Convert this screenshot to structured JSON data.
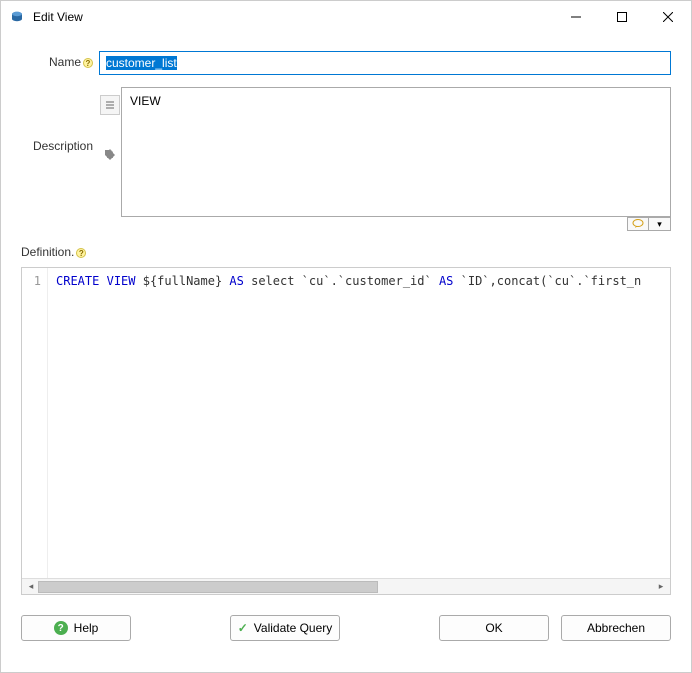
{
  "window": {
    "title": "Edit View"
  },
  "form": {
    "name_label": "Name",
    "name_value": "customer_list",
    "description_label": "Description",
    "description_value": "VIEW",
    "definition_label": "Definition."
  },
  "code": {
    "line_number": "1",
    "tokens": {
      "create": "CREATE",
      "view": "VIEW",
      "placeholder": " ${fullName} ",
      "as": "AS",
      "select": " select `cu`.`customer_id` ",
      "as2": "AS",
      "rest": " `ID`,concat(`cu`.`first_n"
    }
  },
  "buttons": {
    "help": "Help",
    "validate": "Validate Query",
    "ok": "OK",
    "cancel": "Abbrechen"
  }
}
